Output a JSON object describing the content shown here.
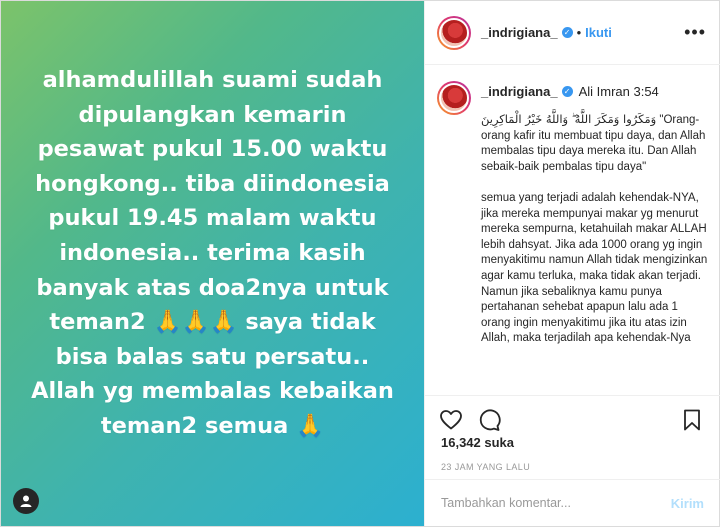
{
  "image": {
    "lines": [
      "alhamdulillah suami sudah",
      "dipulangkan kemarin",
      "pesawat pukul 15.00 waktu",
      "hongkong.. tiba diindonesia",
      "pukul 19.45 malam waktu",
      "indonesia.. terima kasih",
      "banyak atas doa2nya untuk",
      "saya tidak",
      "bisa balas satu persatu..",
      "Allah yg membalas kebaikan",
      "teman2 semua"
    ],
    "line8_prefix": "teman2",
    "hands_emoji": "🙏🙏🙏",
    "hand_emoji": "🙏",
    "gradient": [
      "#7cc36a",
      "#2cb0d0"
    ]
  },
  "header": {
    "username": "_indrigiana_",
    "follow_label": "Ikuti",
    "dot": "•",
    "more_label": "•••"
  },
  "caption": {
    "username": "_indrigiana_",
    "reference": "Ali Imran 3:54",
    "arabic": "وَمَكَرُوا وَمَكَرَ اللَّهُ ۖ وَاللَّهُ خَيْرُ الْمَاكِرِينَ",
    "translation": "\"Orang-orang kafir itu membuat tipu daya, dan Allah membalas tipu daya mereka itu. Dan Allah sebaik-baik pembalas tipu daya\"",
    "paragraph": "semua yang terjadi adalah kehendak-NYA, jika mereka mempunyai makar yg menurut mereka sempurna, ketahuilah makar ALLAH lebih dahsyat. Jika ada 1000 orang yg ingin menyakitimu namun Allah tidak mengizinkan agar kamu terluka, maka tidak akan terjadi. Namun jika sebaliknya kamu punya pertahanan sehebat apapun lalu ada 1 orang ingin menyakitimu jika itu atas izin Allah, maka terjadilah apa kehendak-Nya"
  },
  "stats": {
    "likes_count": "16,342",
    "likes_label": "suka",
    "time_ago": "23 JAM YANG LALU"
  },
  "comment": {
    "placeholder": "Tambahkan komentar...",
    "post_label": "Kirim"
  },
  "colors": {
    "link": "#3897f0",
    "post_disabled": "#b2dffc",
    "border": "#efefef"
  }
}
